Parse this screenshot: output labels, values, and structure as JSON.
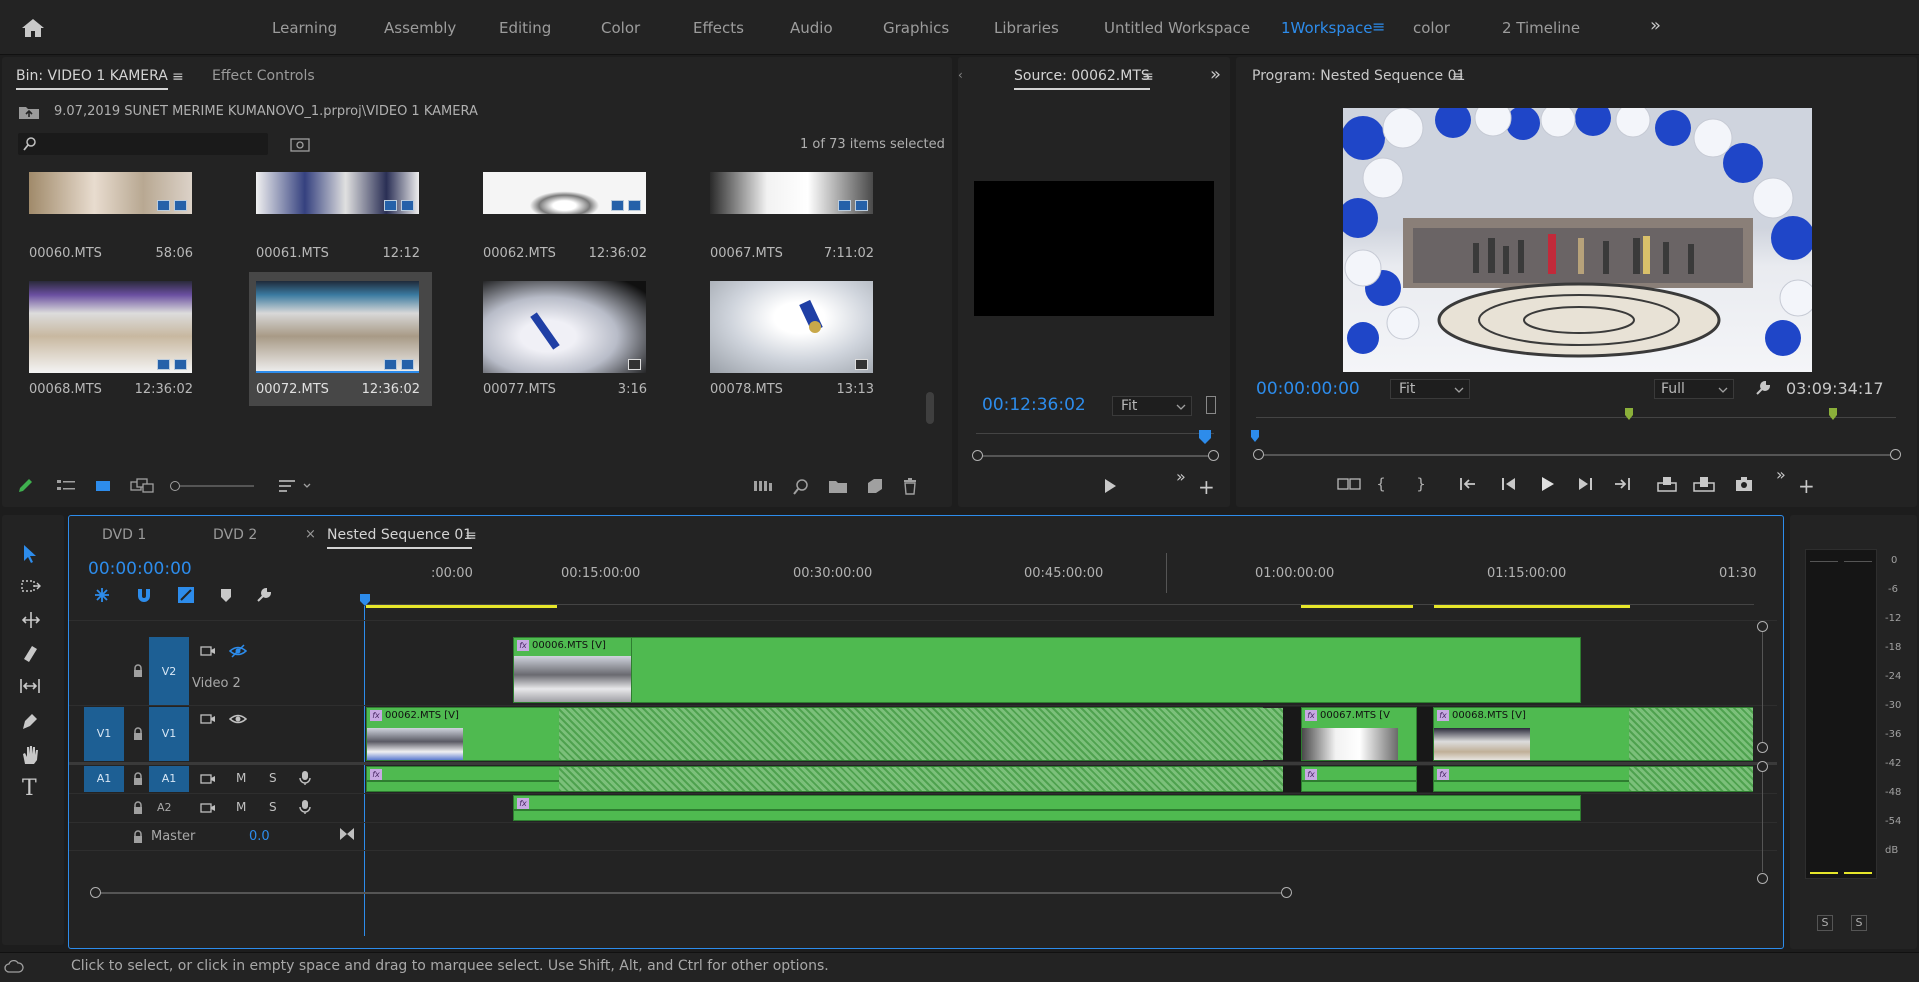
{
  "workspace_tabs": [
    {
      "label": "Learning",
      "active": false
    },
    {
      "label": "Assembly",
      "active": false
    },
    {
      "label": "Editing",
      "active": false
    },
    {
      "label": "Color",
      "active": false
    },
    {
      "label": "Effects",
      "active": false
    },
    {
      "label": "Audio",
      "active": false
    },
    {
      "label": "Graphics",
      "active": false
    },
    {
      "label": "Libraries",
      "active": false
    },
    {
      "label": "Untitled Workspace",
      "active": false
    },
    {
      "label": "1Workspace",
      "active": true
    },
    {
      "label": "color",
      "active": false
    },
    {
      "label": "2 Timeline",
      "active": false
    }
  ],
  "overflow_glyph": "»",
  "bin": {
    "tab_label": "Bin: VIDEO  1 KAMERA",
    "effect_controls_label": "Effect Controls",
    "path": "9.07,2019  SUNET MERIME KUMANOVO_1.prproj\\VIDEO  1 KAMERA",
    "search_placeholder": "",
    "selection_status": "1 of 73 items selected",
    "items": [
      {
        "name": "00060.MTS",
        "duration": "58:06"
      },
      {
        "name": "00061.MTS",
        "duration": "12:12"
      },
      {
        "name": "00062.MTS",
        "duration": "12:36:02"
      },
      {
        "name": "00067.MTS",
        "duration": "7:11:02"
      },
      {
        "name": "00068.MTS",
        "duration": "12:36:02"
      },
      {
        "name": "00072.MTS",
        "duration": "12:36:02"
      },
      {
        "name": "00077.MTS",
        "duration": "3:16"
      },
      {
        "name": "00078.MTS",
        "duration": "13:13"
      }
    ]
  },
  "source": {
    "tab_label": "Source: 00062.MTS",
    "timecode": "00:12:36:02",
    "fit_label": "Fit"
  },
  "program": {
    "tab_label": "Program: Nested Sequence 01",
    "timecode": "00:00:00:00",
    "fit_label": "Fit",
    "quality_label": "Full",
    "duration": "03:09:34:17"
  },
  "timeline": {
    "tabs": [
      {
        "label": "DVD 1",
        "active": false
      },
      {
        "label": "DVD 2",
        "active": false
      },
      {
        "label": "Nested Sequence 01",
        "active": true
      }
    ],
    "close_glyph": "×",
    "timecode": "00:00:00:00",
    "ruler_labels": [
      ":00:00",
      "00:15:00:00",
      "00:30:00:00",
      "00:45:00:00",
      "01:00:00:00",
      "01:15:00:00",
      "01:30"
    ],
    "tracks": {
      "v2": {
        "src": "",
        "name": "V2",
        "label": "Video 2"
      },
      "v1": {
        "src": "V1",
        "name": "V1"
      },
      "a1": {
        "src": "A1",
        "name": "A1",
        "m": "M",
        "s": "S"
      },
      "a2": {
        "name": "A2",
        "m": "M",
        "s": "S"
      },
      "master": {
        "label": "Master",
        "value": "0.0"
      }
    },
    "clips": {
      "v2_a": "00006.MTS [V]",
      "v1_a": "00062.MTS [V]",
      "v1_b": "00067.MTS [V",
      "v1_c": "00068.MTS [V]"
    },
    "fx_label": "fx"
  },
  "meter": {
    "ticks": [
      "0",
      "-6",
      "-12",
      "-18",
      "-24",
      "-30",
      "-36",
      "-42",
      "-48",
      "-54",
      "dB"
    ],
    "solo_labels": [
      "S",
      "S"
    ]
  },
  "status_bar": {
    "text": "Click to select, or click in empty space and drag to marquee select. Use Shift, Alt, and Ctrl for other options."
  },
  "colors": {
    "accent_blue": "#2d8ceb",
    "clip_green": "#4fba50",
    "track_target_blue": "#1d5f94",
    "in_out_yellow": "#e6e62a"
  }
}
